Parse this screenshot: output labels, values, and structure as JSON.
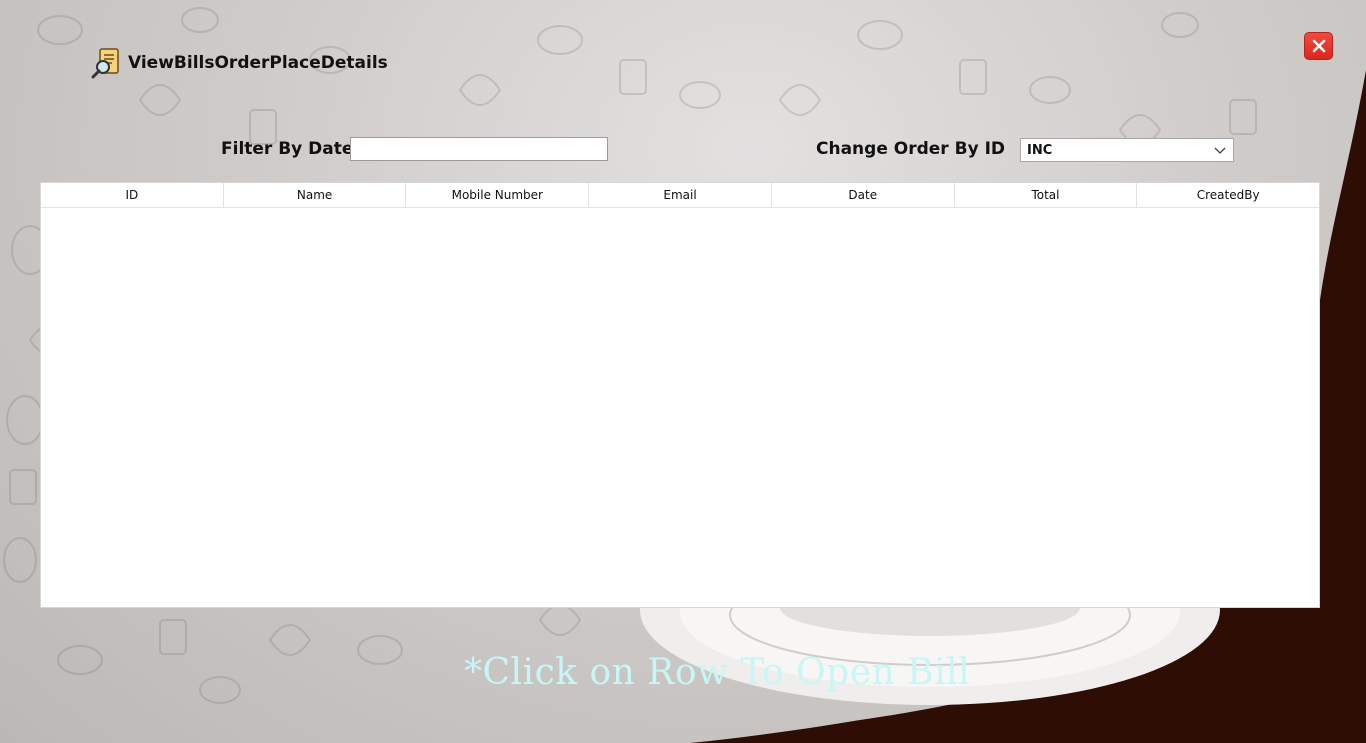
{
  "window": {
    "title": "ViewBillsOrderPlaceDetails",
    "title_icon": "bill-search-icon",
    "close_icon": "close-icon"
  },
  "filters": {
    "date_label": "Filter By Date",
    "date_value": "",
    "order_label": "Change Order By ID",
    "order_selected": "INC",
    "order_icon": "chevron-down-icon"
  },
  "table": {
    "columns": [
      "ID",
      "Name",
      "Mobile Number",
      "Email",
      "Date",
      "Total",
      "CreatedBy"
    ],
    "rows": []
  },
  "footer": {
    "hint": "*Click on Row To Open Bill"
  },
  "colors": {
    "background_gray": "#c9c6c4",
    "background_brown": "#2e0d04",
    "close_red": "#e5392f",
    "hint_cyan": "#c8f6f6"
  }
}
